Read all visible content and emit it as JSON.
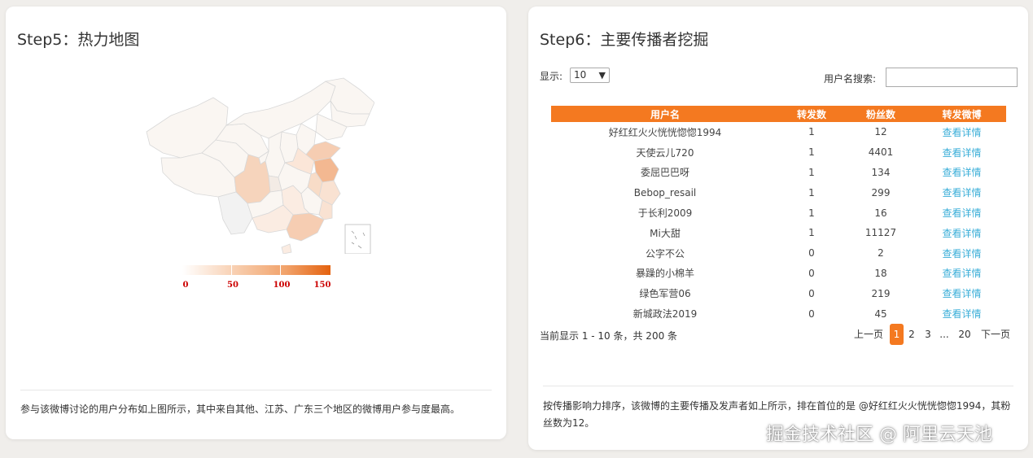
{
  "left": {
    "title": "Step5：热力地图",
    "legend": {
      "labels": [
        "0",
        "50",
        "100",
        "150"
      ],
      "min": 0,
      "max": 150,
      "low_color": "#ffffff",
      "high_color": "#e4620f"
    },
    "description": "参与该微博讨论的用户分布如上图所示，其中来自其他、江苏、广东三个地区的微博用户参与度最高。"
  },
  "right": {
    "title": "Step6：主要传播者挖掘",
    "show_label": "显示:",
    "page_size": "10",
    "search_label": "用户名搜索:",
    "search_value": "",
    "columns": [
      "用户名",
      "转发数",
      "粉丝数",
      "转发微博"
    ],
    "rows": [
      {
        "name": "好红红火火恍恍惚惚1994",
        "reposts": "1",
        "fans": "12",
        "detail": "查看详情"
      },
      {
        "name": "天使云儿720",
        "reposts": "1",
        "fans": "4401",
        "detail": "查看详情"
      },
      {
        "name": "委屈巴巴呀",
        "reposts": "1",
        "fans": "134",
        "detail": "查看详情"
      },
      {
        "name": "Bebop_resail",
        "reposts": "1",
        "fans": "299",
        "detail": "查看详情"
      },
      {
        "name": "于长利2009",
        "reposts": "1",
        "fans": "16",
        "detail": "查看详情"
      },
      {
        "name": "Mi大甜",
        "reposts": "1",
        "fans": "11127",
        "detail": "查看详情"
      },
      {
        "name": "公字不公",
        "reposts": "0",
        "fans": "2",
        "detail": "查看详情"
      },
      {
        "name": "暴躁的小棉羊",
        "reposts": "0",
        "fans": "18",
        "detail": "查看详情"
      },
      {
        "name": "绿色军营06",
        "reposts": "0",
        "fans": "219",
        "detail": "查看详情"
      },
      {
        "name": "新城政法2019",
        "reposts": "0",
        "fans": "45",
        "detail": "查看详情"
      }
    ],
    "info": "当前显示 1 - 10 条，共 200 条",
    "pagination": {
      "prev": "上一页",
      "pages": [
        "1",
        "2",
        "3",
        "...",
        "20"
      ],
      "current": "1",
      "next": "下一页"
    },
    "description": "按传播影响力排序，该微博的主要传播及发声者如上所示，排在首位的是 @好红红火火恍恍惚惚1994，其粉丝数为12。"
  },
  "watermark": "掘金技术社区 @ 阿里云天池",
  "colors": {
    "accent": "#f47920",
    "link": "#3aaed8"
  }
}
